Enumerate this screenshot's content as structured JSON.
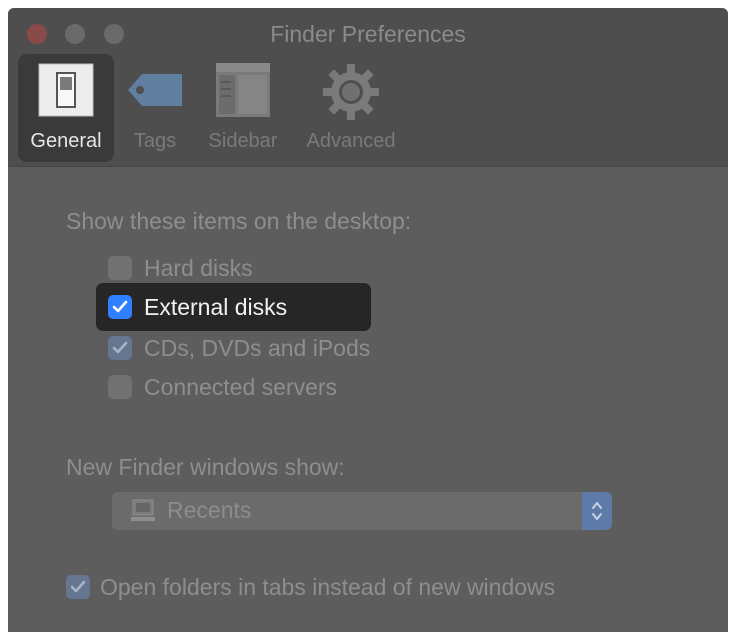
{
  "window": {
    "title": "Finder Preferences"
  },
  "toolbar": {
    "tabs": [
      {
        "label": "General",
        "icon": "general-switch-icon",
        "selected": true
      },
      {
        "label": "Tags",
        "icon": "tag-icon",
        "selected": false
      },
      {
        "label": "Sidebar",
        "icon": "sidebar-icon",
        "selected": false
      },
      {
        "label": "Advanced",
        "icon": "gear-icon",
        "selected": false
      }
    ]
  },
  "desktop_items": {
    "heading": "Show these items on the desktop:",
    "items": [
      {
        "label": "Hard disks",
        "checked": false
      },
      {
        "label": "External disks",
        "checked": true,
        "highlighted": true
      },
      {
        "label": "CDs, DVDs and iPods",
        "checked": true
      },
      {
        "label": "Connected servers",
        "checked": false
      }
    ]
  },
  "new_window": {
    "heading": "New Finder windows show:",
    "selected": "Recents",
    "icon": "computer-icon"
  },
  "tabs_option": {
    "label": "Open folders in tabs instead of new windows",
    "checked": true
  },
  "colors": {
    "accent": "#2f80ff",
    "window_bg": "#5d5d5d",
    "highlight_bg": "#262626"
  }
}
